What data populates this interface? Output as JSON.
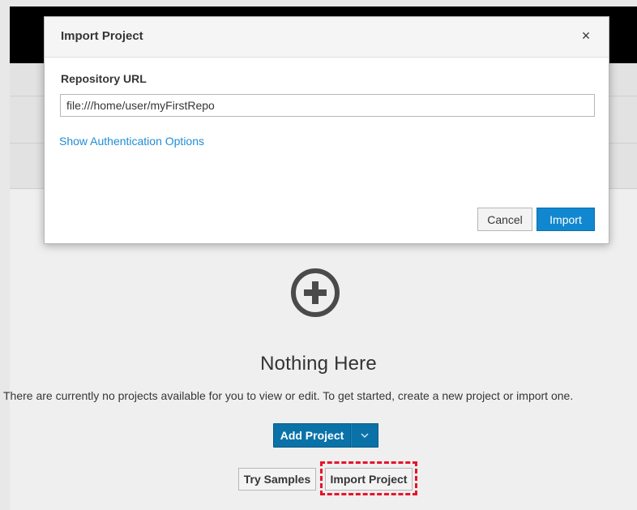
{
  "modal": {
    "title": "Import Project",
    "close_icon": "close-icon",
    "field_label": "Repository URL",
    "url_value": "file:///home/user/myFirstRepo",
    "auth_link": "Show Authentication Options",
    "cancel_label": "Cancel",
    "import_label": "Import"
  },
  "empty_state": {
    "icon": "plus-circle-icon",
    "title": "Nothing Here",
    "text": "There are currently no projects available for you to view or edit. To get started, create a new project or import one.",
    "add_project_label": "Add Project",
    "dropdown_icon": "chevron-down-icon",
    "try_samples_label": "Try Samples",
    "import_project_label": "Import Project"
  },
  "colors": {
    "primary": "#1187d0",
    "dark_primary": "#0b72a8",
    "link": "#1f8dd6",
    "highlight": "#e8132b"
  }
}
